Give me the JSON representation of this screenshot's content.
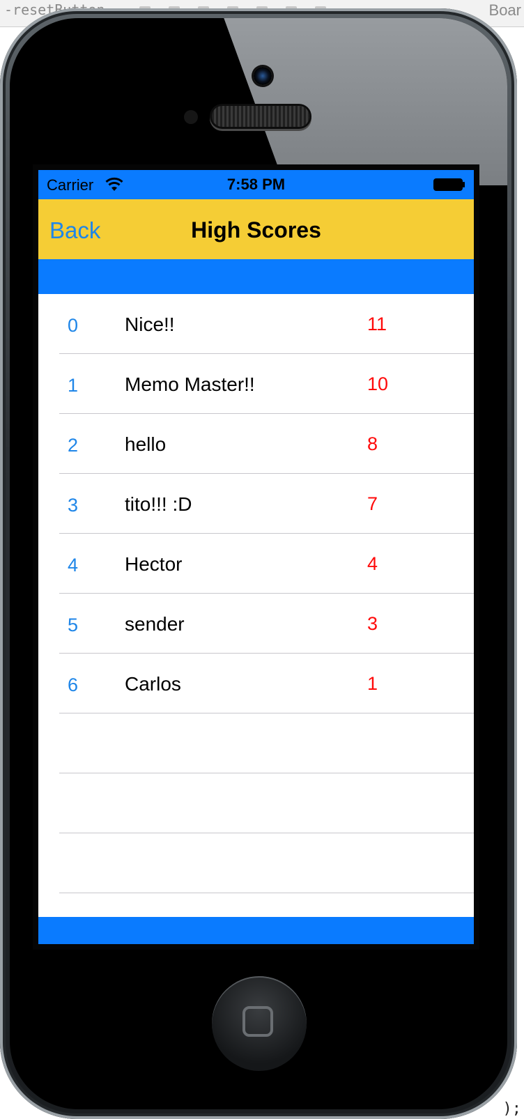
{
  "editor": {
    "left_text": "-resetButton",
    "right_text": "Boar",
    "corner_code": ");"
  },
  "status_bar": {
    "carrier": "Carrier",
    "time": "7:58 PM"
  },
  "nav": {
    "back_label": "Back",
    "title": "High Scores"
  },
  "scores": [
    {
      "rank": "0",
      "name": "Nice!!",
      "score": "11"
    },
    {
      "rank": "1",
      "name": "Memo Master!!",
      "score": "10"
    },
    {
      "rank": "2",
      "name": "hello",
      "score": "8"
    },
    {
      "rank": "3",
      "name": "tito!!! :D",
      "score": "7"
    },
    {
      "rank": "4",
      "name": "Hector",
      "score": "4"
    },
    {
      "rank": "5",
      "name": "sender",
      "score": "3"
    },
    {
      "rank": "6",
      "name": "Carlos",
      "score": "1"
    }
  ],
  "empty_rows": 3,
  "colors": {
    "status_bar": "#0a7bff",
    "nav_bar": "#f5cd35",
    "rank_text": "#1f86e8",
    "score_text": "#ff0a0a"
  }
}
